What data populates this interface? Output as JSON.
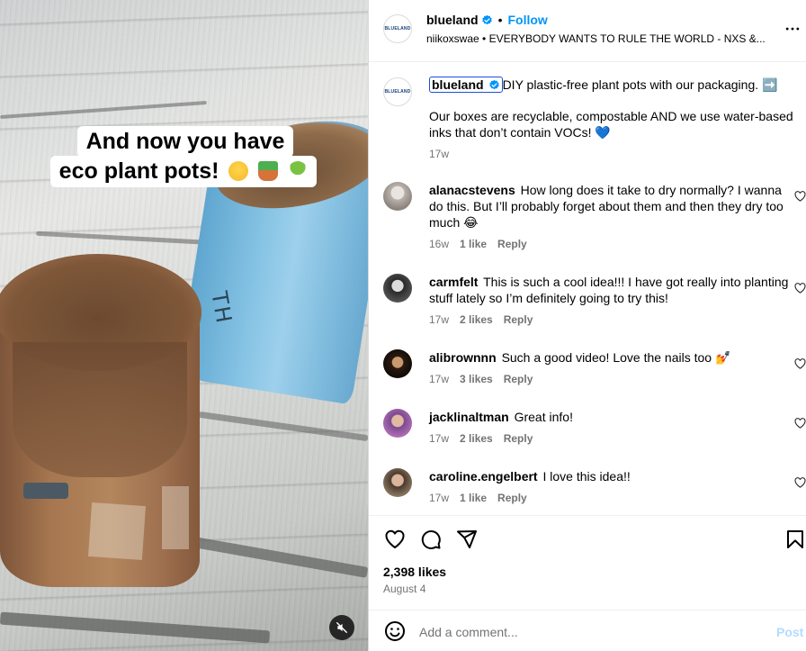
{
  "post": {
    "account": "blueland",
    "logo_text": "BLUELAND",
    "follow_label": "Follow",
    "audio": "niikoxswae • EVERYBODY WANTS TO RULE THE WORLD - NXS &...",
    "caption_line1": "DIY plastic-free plant pots with our packaging. ➡️",
    "caption_line2": "Our boxes are recyclable, compostable AND we use water-based inks that don’t contain VOCs! 💙",
    "caption_time": "17w"
  },
  "media": {
    "caption_top": "And now you have",
    "caption_bottom": "eco plant pots!",
    "pot_text": "TH"
  },
  "comments": [
    {
      "user": "alanacstevens",
      "text": "How long does it take to dry normally? I wanna do this. But I’ll probably forget about them and then they dry too much 😂",
      "time": "16w",
      "likes": "1 like",
      "reply": "Reply"
    },
    {
      "user": "carmfelt",
      "text": "This is such a cool idea!!! I have got really into planting stuff lately so I’m definitely going to try this!",
      "time": "17w",
      "likes": "2 likes",
      "reply": "Reply"
    },
    {
      "user": "alibrownnn",
      "text": "Such a good video! Love the nails too 💅",
      "time": "17w",
      "likes": "3 likes",
      "reply": "Reply"
    },
    {
      "user": "jacklinaltman",
      "text": "Great info!",
      "time": "17w",
      "likes": "2 likes",
      "reply": "Reply"
    },
    {
      "user": "caroline.engelbert",
      "text": "I love this idea!!",
      "time": "17w",
      "likes": "1 like",
      "reply": "Reply"
    }
  ],
  "footer": {
    "likes": "2,398 likes",
    "date": "August 4",
    "comment_placeholder": "Add a comment...",
    "post_label": "Post"
  },
  "colors": {
    "accent": "#0095f6",
    "verified": "#0095f6",
    "post_disabled": "#b3dbff",
    "secondary_text": "#737373"
  },
  "icons": [
    "verified-badge-icon",
    "more-options-icon",
    "heart-icon",
    "comment-icon",
    "share-icon",
    "bookmark-icon",
    "emoji-icon",
    "mute-icon"
  ]
}
